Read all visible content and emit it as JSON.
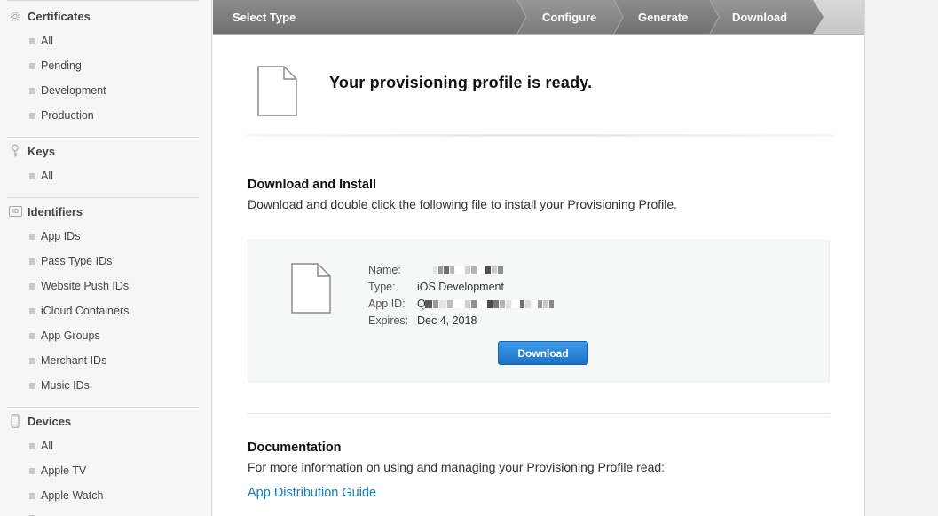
{
  "sidebar": {
    "certificates": {
      "label": "Certificates",
      "items": [
        "All",
        "Pending",
        "Development",
        "Production"
      ]
    },
    "keys": {
      "label": "Keys",
      "items": [
        "All"
      ]
    },
    "identifiers": {
      "label": "Identifiers",
      "icon_text": "ID",
      "items": [
        "App IDs",
        "Pass Type IDs",
        "Website Push IDs",
        "iCloud Containers",
        "App Groups",
        "Merchant IDs",
        "Music IDs"
      ]
    },
    "devices": {
      "label": "Devices",
      "items": [
        "All",
        "Apple TV",
        "Apple Watch"
      ]
    }
  },
  "steps": [
    "Select Type",
    "Configure",
    "Generate",
    "Download"
  ],
  "ready": {
    "title": "Your provisioning profile is ready."
  },
  "download_install": {
    "heading": "Download and Install",
    "description": "Download and double click the following file to install your Provisioning Profile."
  },
  "profile": {
    "name_label": "Name:",
    "type_label": "Type:",
    "type_value": "iOS Development",
    "appid_label": "App ID:",
    "appid_prefix": "Q",
    "expires_label": "Expires:",
    "expires_value": "Dec 4, 2018",
    "download_label": "Download"
  },
  "documentation": {
    "heading": "Documentation",
    "description": "For more information on using and managing your Provisioning Profile read:",
    "link": "App Distribution Guide"
  },
  "colors": {
    "accent": "#1a72c8",
    "link": "#0b7fc7",
    "step_bar": "#bdbdbd"
  }
}
